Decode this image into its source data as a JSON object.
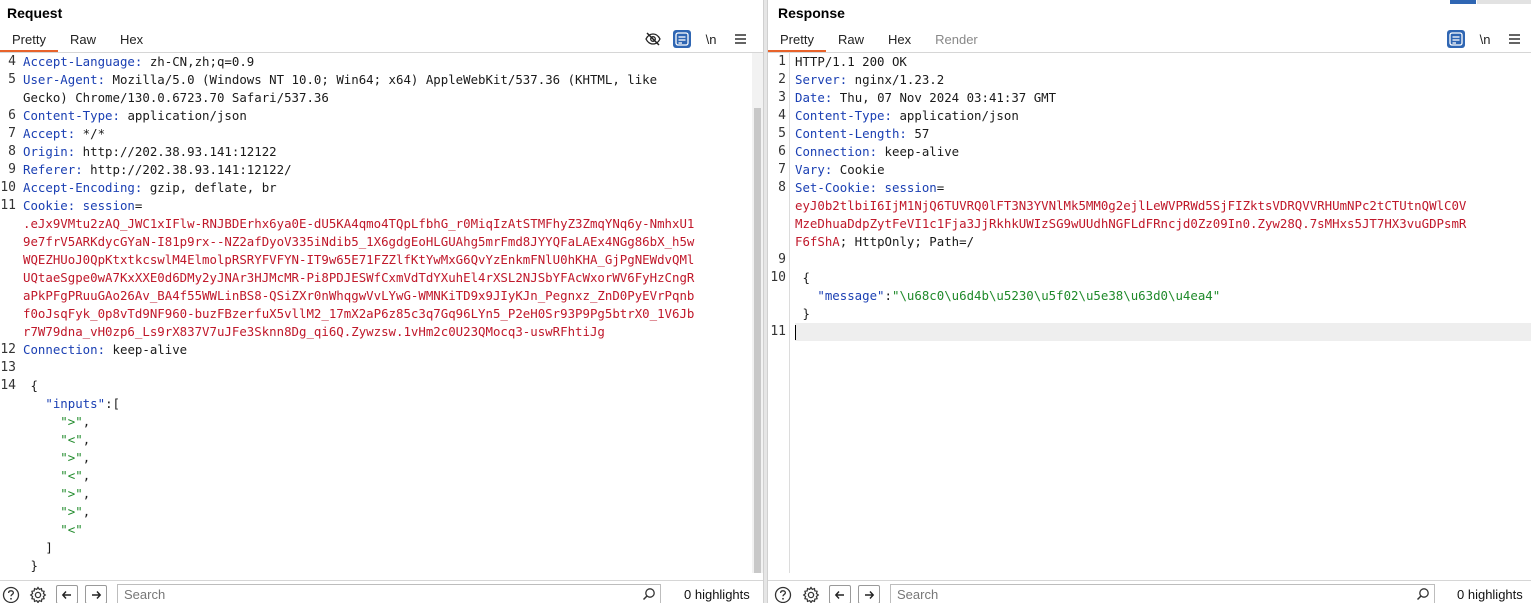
{
  "request": {
    "title": "Request",
    "tabs": [
      {
        "label": "Pretty",
        "active": true
      },
      {
        "label": "Raw"
      },
      {
        "label": "Hex"
      }
    ],
    "tools": {
      "newline_label": "\\n"
    },
    "lines": [
      {
        "n": "4",
        "segments": [
          {
            "t": "Accept-Language:",
            "c": "hdr-name"
          },
          {
            "t": " zh-CN,zh;q=0.9",
            "c": "plain"
          }
        ]
      },
      {
        "n": "5",
        "segments": [
          {
            "t": "User-Agent:",
            "c": "hdr-name"
          },
          {
            "t": " Mozilla/5.0 (Windows NT 10.0; Win64; x64) AppleWebKit/537.36 (KHTML, like",
            "c": "plain"
          }
        ]
      },
      {
        "n": "",
        "segments": [
          {
            "t": "Gecko) Chrome/130.0.6723.70 Safari/537.36",
            "c": "plain"
          }
        ]
      },
      {
        "n": "6",
        "segments": [
          {
            "t": "Content-Type:",
            "c": "hdr-name"
          },
          {
            "t": " application/json",
            "c": "plain"
          }
        ]
      },
      {
        "n": "7",
        "segments": [
          {
            "t": "Accept:",
            "c": "hdr-name"
          },
          {
            "t": " */*",
            "c": "plain"
          }
        ]
      },
      {
        "n": "8",
        "segments": [
          {
            "t": "Origin:",
            "c": "hdr-name"
          },
          {
            "t": " http://202.38.93.141:12122",
            "c": "plain"
          }
        ]
      },
      {
        "n": "9",
        "segments": [
          {
            "t": "Referer:",
            "c": "hdr-name"
          },
          {
            "t": " http://202.38.93.141:12122/",
            "c": "plain"
          }
        ]
      },
      {
        "n": "10",
        "segments": [
          {
            "t": "Accept-Encoding:",
            "c": "hdr-name"
          },
          {
            "t": " gzip, deflate, br",
            "c": "plain"
          }
        ]
      },
      {
        "n": "11",
        "segments": [
          {
            "t": "Cookie:",
            "c": "hdr-name"
          },
          {
            "t": " session",
            "c": "blue"
          },
          {
            "t": "=",
            "c": "plain"
          }
        ]
      },
      {
        "n": "",
        "segments": [
          {
            "t": ".eJx9VMtu2zAQ_JWC1xIFlw-RNJBDErhx6ya0E-dU5KA4qmo4TQpLfbhG_r0MiqIzAtSTMFhyZ3ZmqYNq6y-NmhxU1",
            "c": "red"
          }
        ]
      },
      {
        "n": "",
        "segments": [
          {
            "t": "9e7frV5ARKdycGYaN-I81p9rx--NZ2afDyoV335iNdib5_1X6gdgEoHLGUAhg5mrFmd8JYYQFaLAEx4NGg86bX_h5w",
            "c": "red"
          }
        ]
      },
      {
        "n": "",
        "segments": [
          {
            "t": "WQEZHUoJ0QpKtxtkcswlM4ElmolpRSRYFVFYN-IT9w65E71FZZlfKtYwMxG6QvYzEnkmFNlU0hKHA_GjPgNEWdvQMl",
            "c": "red"
          }
        ]
      },
      {
        "n": "",
        "segments": [
          {
            "t": "UQtaeSgpe0wA7KxXXE0d6DMy2yJNAr3HJMcMR-Pi8PDJESWfCxmVdTdYXuhEl4rXSL2NJSbYFAcWxorWV6FyHzCngR",
            "c": "red"
          }
        ]
      },
      {
        "n": "",
        "segments": [
          {
            "t": "aPkPFgPRuuGAo26Av_BA4f55WWLinBS8-QSiZXr0nWhqgwVvLYwG-WMNKiTD9x9JIyKJn_Pegnxz_ZnD0PyEVrPqnb",
            "c": "red"
          }
        ]
      },
      {
        "n": "",
        "segments": [
          {
            "t": "f0oJsqFyk_0p8vTd9NF960-buzFBzerfuX5vllM2_17mX2aP6z85c3q7Gq96LYn5_P2eH0Sr93P9Pg5btrX0_1V6Jb",
            "c": "red"
          }
        ]
      },
      {
        "n": "",
        "segments": [
          {
            "t": "r7W79dna_vH0zp6_Ls9rX837V7uJFe3Sknn8Dg_qi6Q.Zywzsw.1vHm2c0U23QMocq3-uswRFhtiJg",
            "c": "red"
          }
        ]
      },
      {
        "n": "12",
        "segments": [
          {
            "t": "Connection:",
            "c": "hdr-name"
          },
          {
            "t": " keep-alive",
            "c": "plain"
          }
        ]
      },
      {
        "n": "13",
        "segments": []
      },
      {
        "n": "14",
        "segments": [
          {
            "t": " {",
            "c": "plain"
          }
        ]
      },
      {
        "n": "",
        "segments": [
          {
            "t": "   \"inputs\"",
            "c": "blue"
          },
          {
            "t": ":[",
            "c": "plain"
          }
        ]
      },
      {
        "n": "",
        "segments": [
          {
            "t": "     \">\"",
            "c": "green"
          },
          {
            "t": ",",
            "c": "plain"
          }
        ]
      },
      {
        "n": "",
        "segments": [
          {
            "t": "     \"<\"",
            "c": "green"
          },
          {
            "t": ",",
            "c": "plain"
          }
        ]
      },
      {
        "n": "",
        "segments": [
          {
            "t": "     \">\"",
            "c": "green"
          },
          {
            "t": ",",
            "c": "plain"
          }
        ]
      },
      {
        "n": "",
        "segments": [
          {
            "t": "     \"<\"",
            "c": "green"
          },
          {
            "t": ",",
            "c": "plain"
          }
        ]
      },
      {
        "n": "",
        "segments": [
          {
            "t": "     \">\"",
            "c": "green"
          },
          {
            "t": ",",
            "c": "plain"
          }
        ]
      },
      {
        "n": "",
        "segments": [
          {
            "t": "     \">\"",
            "c": "green"
          },
          {
            "t": ",",
            "c": "plain"
          }
        ]
      },
      {
        "n": "",
        "segments": [
          {
            "t": "     \"<\"",
            "c": "green"
          }
        ]
      },
      {
        "n": "",
        "segments": [
          {
            "t": "   ]",
            "c": "plain"
          }
        ]
      },
      {
        "n": "",
        "segments": [
          {
            "t": " }",
            "c": "plain"
          }
        ]
      }
    ],
    "search_placeholder": "Search",
    "highlights": "0 highlights"
  },
  "response": {
    "title": "Response",
    "tabs": [
      {
        "label": "Pretty",
        "active": true
      },
      {
        "label": "Raw"
      },
      {
        "label": "Hex"
      },
      {
        "label": "Render",
        "disabled": true
      }
    ],
    "tools": {
      "newline_label": "\\n"
    },
    "lines": [
      {
        "n": "1",
        "segments": [
          {
            "t": "HTTP/1.1 200 OK",
            "c": "plain"
          }
        ]
      },
      {
        "n": "2",
        "segments": [
          {
            "t": "Server:",
            "c": "hdr-name"
          },
          {
            "t": " nginx/1.23.2",
            "c": "plain"
          }
        ]
      },
      {
        "n": "3",
        "segments": [
          {
            "t": "Date:",
            "c": "hdr-name"
          },
          {
            "t": " Thu, 07 Nov 2024 03:41:37 GMT",
            "c": "plain"
          }
        ]
      },
      {
        "n": "4",
        "segments": [
          {
            "t": "Content-Type:",
            "c": "hdr-name"
          },
          {
            "t": " application/json",
            "c": "plain"
          }
        ]
      },
      {
        "n": "5",
        "segments": [
          {
            "t": "Content-Length:",
            "c": "hdr-name"
          },
          {
            "t": " 57",
            "c": "plain"
          }
        ]
      },
      {
        "n": "6",
        "segments": [
          {
            "t": "Connection:",
            "c": "hdr-name"
          },
          {
            "t": " keep-alive",
            "c": "plain"
          }
        ]
      },
      {
        "n": "7",
        "segments": [
          {
            "t": "Vary:",
            "c": "hdr-name"
          },
          {
            "t": " Cookie",
            "c": "plain"
          }
        ]
      },
      {
        "n": "8",
        "segments": [
          {
            "t": "Set-Cookie:",
            "c": "hdr-name"
          },
          {
            "t": " session",
            "c": "blue"
          },
          {
            "t": "=",
            "c": "plain"
          }
        ]
      },
      {
        "n": "",
        "segments": [
          {
            "t": "eyJ0b2tlbiI6IjM1NjQ6TUVRQ0lFT3N3YVNlMk5MM0g2ejlLeWVPRWd5SjFIZktsVDRQVVRHUmNPc2tCTUtnQWlC0V",
            "c": "red"
          }
        ]
      },
      {
        "n": "",
        "segments": [
          {
            "t": "MzeDhuaDdpZytFeVI1c1Fja3JjRkhkUWIzSG9wUUdhNGFLdFRncjd0Zz09In0.Zyw28Q.7sMHxs5JT7HX3vuGDPsmR",
            "c": "red"
          }
        ]
      },
      {
        "n": "",
        "segments": [
          {
            "t": "F6fShA",
            "c": "red"
          },
          {
            "t": "; HttpOnly; Path=/",
            "c": "plain"
          }
        ]
      },
      {
        "n": "9",
        "segments": []
      },
      {
        "n": "10",
        "segments": [
          {
            "t": " {",
            "c": "plain"
          }
        ]
      },
      {
        "n": "",
        "segments": [
          {
            "t": "   \"message\"",
            "c": "blue"
          },
          {
            "t": ":",
            "c": "plain"
          },
          {
            "t": "\"\\u68c0\\u6d4b\\u5230\\u5f02\\u5e38\\u63d0\\u4ea4\"",
            "c": "green"
          }
        ]
      },
      {
        "n": "",
        "segments": [
          {
            "t": " }",
            "c": "plain"
          }
        ]
      },
      {
        "n": "11",
        "segments": [],
        "cursor": true
      }
    ],
    "search_placeholder": "Search",
    "highlights": "0 highlights"
  }
}
